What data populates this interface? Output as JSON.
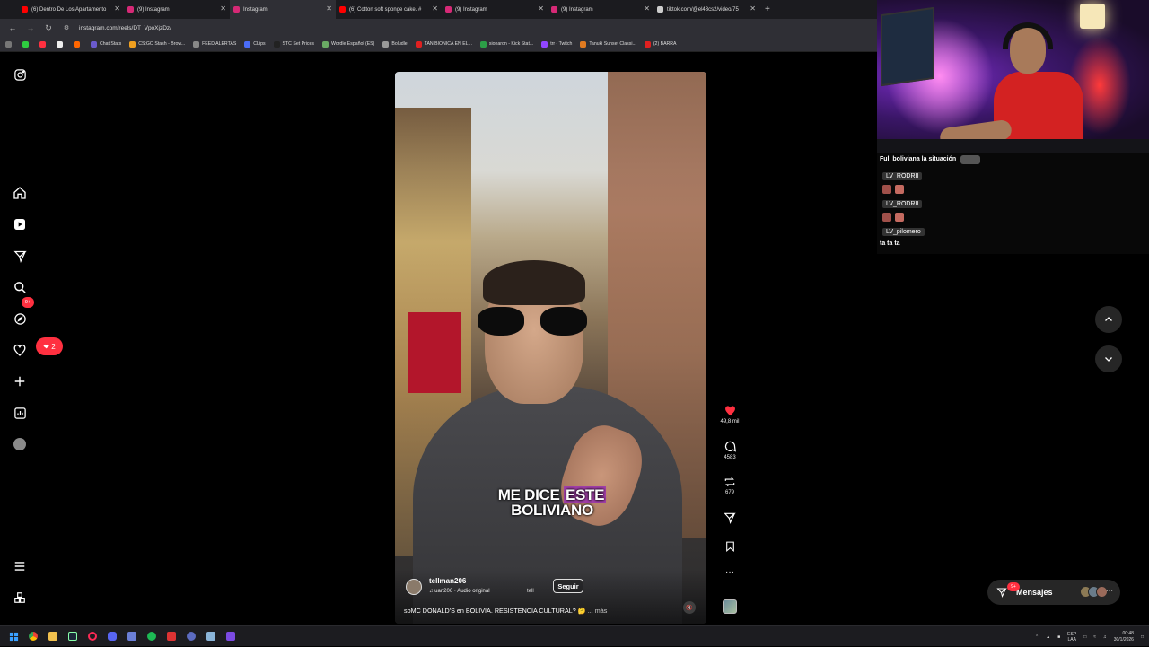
{
  "browser": {
    "tabs": [
      {
        "title": "(6) Dentro De Los Apartamento",
        "color": "#ff0000"
      },
      {
        "title": "(9) Instagram",
        "color": "#d62976"
      },
      {
        "title": "Instagram",
        "color": "#d62976",
        "active": true
      },
      {
        "title": "(6) Cotton soft sponge cake. #",
        "color": "#ff0000"
      },
      {
        "title": "(9) Instagram",
        "color": "#d62976"
      },
      {
        "title": "(9) Instagram",
        "color": "#d62976"
      },
      {
        "title": "tiktok.com/@el43cs2/video/75",
        "color": "#cccccc"
      }
    ],
    "new_tab": "+",
    "url": "instagram.com/reels/DT_VpoXjzDz/",
    "bookmarks": [
      {
        "label": "Chat Stats",
        "color": "#6a5acd"
      },
      {
        "label": "CS:GO Stash - Brow...",
        "color": "#f0a020"
      },
      {
        "label": "FEED ALERTAS",
        "color": "#888888"
      },
      {
        "label": "CLips",
        "color": "#4a6cf7"
      },
      {
        "label": "STC Set Prices",
        "color": "#222222"
      },
      {
        "label": "Wordle Español (ES)",
        "color": "#6aaa64"
      },
      {
        "label": "Boludle",
        "color": "#999999"
      },
      {
        "label": "TAN BIONICA EN EL...",
        "color": "#e02020"
      },
      {
        "label": "sionaron - Kick Stat...",
        "color": "#2c9e47"
      },
      {
        "label": "trr - Twitch",
        "color": "#9146ff"
      },
      {
        "label": "Tanuki Sunset Classi...",
        "color": "#e07a20"
      },
      {
        "label": "(2) BARRA",
        "color": "#e02020"
      }
    ]
  },
  "sidebar": {
    "notifications_count": "2",
    "reels_badge": "9+"
  },
  "reel": {
    "caption_top_plain": "ME DICE",
    "caption_top_highlight": "ESTE",
    "caption_bottom": "BOLIVIANO",
    "username": "tellman206",
    "audio": "uan206 · Audio original",
    "audio_extra": "tell",
    "follow_label": "Seguir",
    "description": "soMC DONALD'S en BOLIVIA. RESISTENCIA CULTURAL? 🤔",
    "more_label": "... más",
    "likes": "49,8 mil",
    "comments": "4583",
    "reposts": "679"
  },
  "messages": {
    "label": "Mensajes",
    "badge": "9+"
  },
  "stream_chat": [
    {
      "type": "text",
      "text": "Full boliviana la situación"
    },
    {
      "type": "user",
      "text": "LV_RODRII"
    },
    {
      "type": "user",
      "text": "LV_RODRII"
    },
    {
      "type": "user",
      "text": "LV_pilomero"
    },
    {
      "type": "text",
      "text": "ta ta ta"
    }
  ],
  "taskbar": {
    "lang_top": "ESP",
    "lang_bottom": "LAA",
    "time": "00:48",
    "date": "30/1/2026"
  },
  "colors": {
    "accent_red": "#ff3040",
    "caption_highlight": "#a23fa9"
  }
}
